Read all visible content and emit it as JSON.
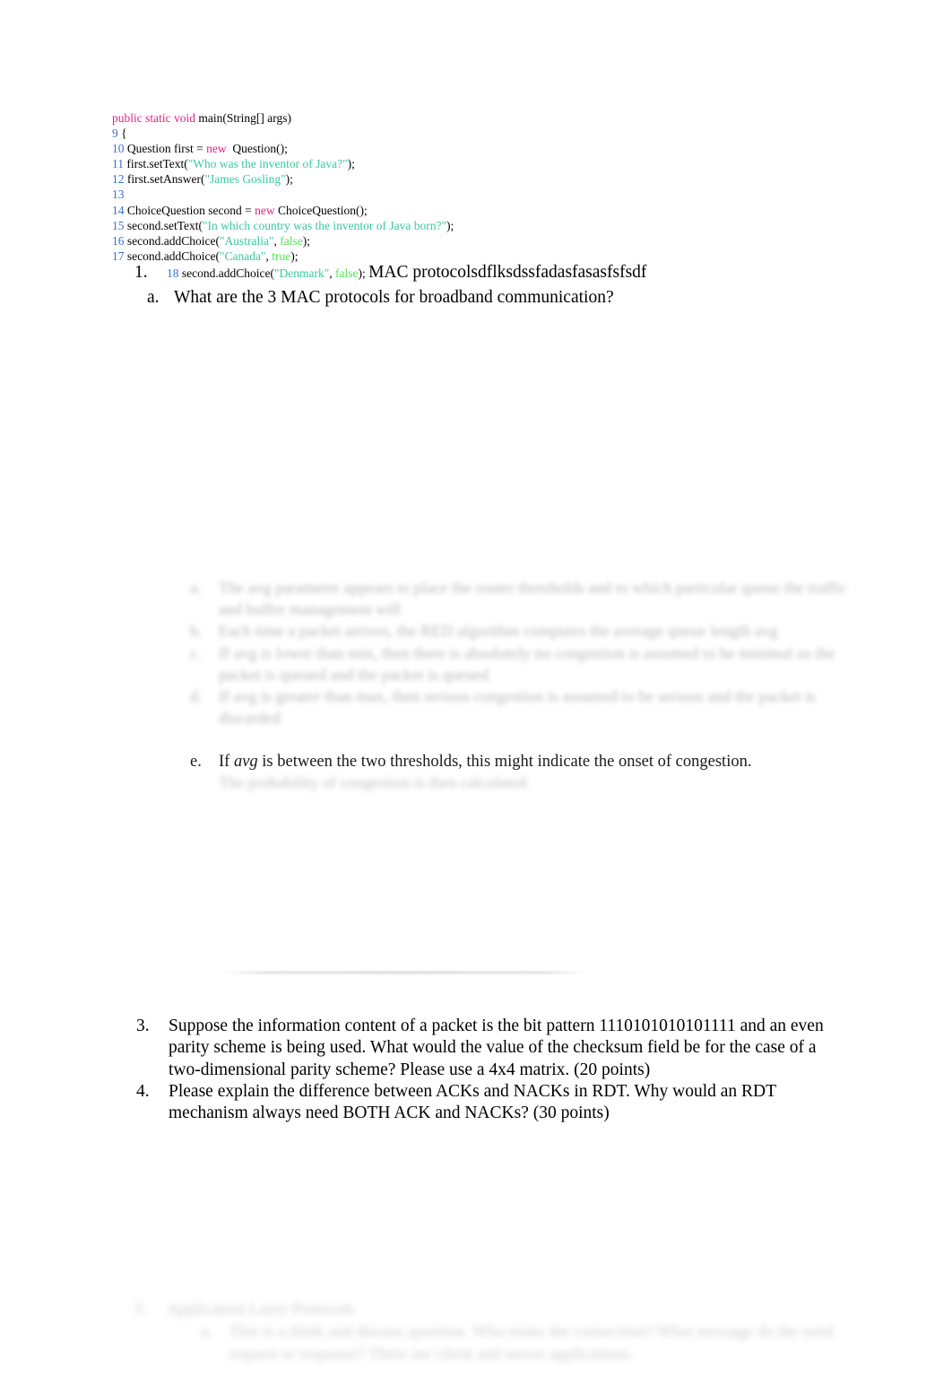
{
  "document": {
    "background_color": "#ffffff",
    "text_color": "#000000"
  },
  "code_listing": {
    "syntax_colors": {
      "keyword": "#e0218a",
      "line_number": "#3a6fd8",
      "string": "#39c9a0",
      "literal": "#5ae05a",
      "plain": "#000000"
    },
    "lines": [
      {
        "number": "",
        "signature_kw": "public static void",
        "signature_rest": " main(String[] args)"
      },
      {
        "number": "9",
        "text": " {"
      },
      {
        "number": "10",
        "text": " Question first = ",
        "kw": "new",
        "tail": "  Question();"
      },
      {
        "number": "11",
        "text": " first.setText(",
        "str": "\"Who was the inventor of Java?\"",
        "tail": ");"
      },
      {
        "number": "12",
        "text": " first.setAnswer(",
        "str": "\"James Gosling\"",
        "tail": ");"
      },
      {
        "number": "13",
        "text": ""
      },
      {
        "number": "14",
        "text": " ChoiceQuestion second = ",
        "kw": "new",
        "tail": " ChoiceQuestion();"
      },
      {
        "number": "15",
        "text": " second.setText(",
        "str": "\"In which country was the inventor of Java born?\"",
        "tail": ");"
      },
      {
        "number": "16",
        "text": " second.addChoice(",
        "str": "\"Australia\"",
        "sep": ", ",
        "lit": "false",
        "tail": ");"
      },
      {
        "number": "17",
        "text": " second.addChoice(",
        "str": "\"Canada\"",
        "sep": ", ",
        "lit": "true",
        "tail": ");"
      }
    ]
  },
  "outline": {
    "item1": {
      "marker": "1.",
      "code_line_number": "18",
      "code_before": " second.addChoice(",
      "code_string": "\"Denmark\"",
      "code_sep": ", ",
      "code_literal": "false",
      "code_after": "); ",
      "text": "MAC protocolsdflksdssfadasfasasfsfsdf"
    },
    "item_a": {
      "marker": "a.",
      "text": "What are the 3 MAC protocols for broadband communication?"
    }
  },
  "faded_middle": {
    "rows": [
      {
        "marker": "a.",
        "text": "The avg parameter appears to place the router thresholds and to which particular queue the traffic and buffer management will"
      },
      {
        "marker": "b.",
        "text": "Each time a packet arrives, the RED algorithm computes the average queue length avg"
      },
      {
        "marker": "c.",
        "text": "If avg is lower than min, then there is absolutely no congestion is assumed to be minimal so the packet is queued and the packet is queued"
      },
      {
        "marker": "d.",
        "text": "If avg is greater than max, then serious congestion is assumed to be serious and the packet is discarded"
      }
    ],
    "sharp_row": {
      "marker": "e.",
      "text_before": "If ",
      "emphasis": "avg",
      "text_after": " is between the two thresholds, this might indicate the onset of congestion."
    },
    "tail_row": "The probability of congestion is then calculated."
  },
  "questions": [
    {
      "marker": "3.",
      "text": "Suppose the information content of a packet is the bit pattern 1110101010101111 and an even parity scheme is being used. What would the value of the checksum field be for the case of a two-dimensional parity scheme? Please use a 4x4 matrix.  (20 points)"
    },
    {
      "marker": "4.",
      "text": "Please explain the difference between ACKs and NACKs in RDT. Why would an RDT mechanism always need BOTH ACK and NACKs? (30 points)"
    }
  ],
  "bottom_faded": {
    "row1": {
      "marker": "5.",
      "text": "Application Layer Protocols"
    },
    "row2": {
      "marker": "a.",
      "text": "This is a think and discuss question. Who make the connection? What message do the send request or response? There are client and server applications."
    }
  }
}
